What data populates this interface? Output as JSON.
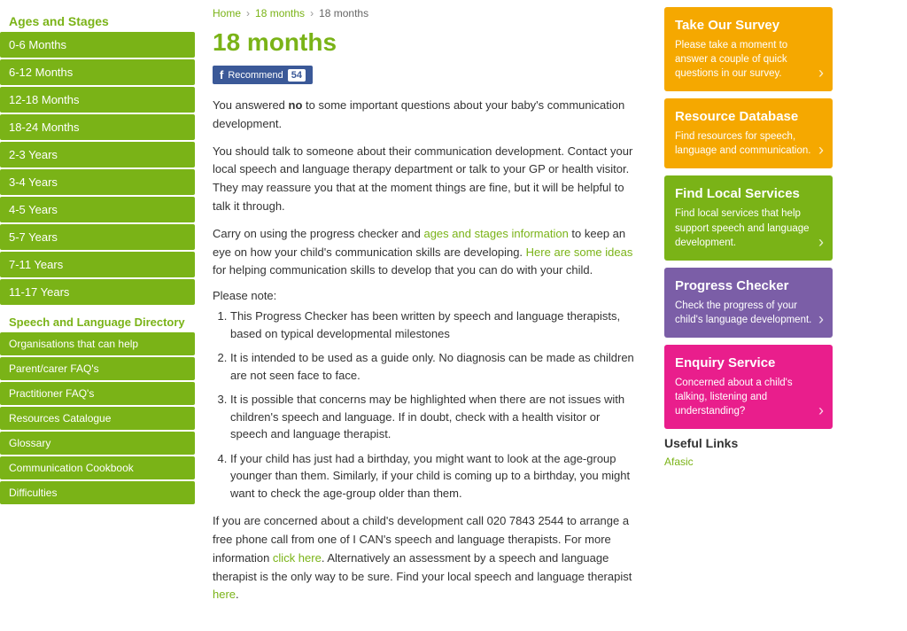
{
  "sidebar": {
    "ages_title": "Ages and Stages",
    "nav_items": [
      "0-6 Months",
      "6-12 Months",
      "12-18 Months",
      "18-24 Months",
      "2-3 Years",
      "3-4 Years",
      "4-5 Years",
      "5-7 Years",
      "7-11 Years",
      "11-17 Years"
    ],
    "directory_title": "Speech and Language Directory",
    "sub_items": [
      "Organisations that can help",
      "Parent/carer FAQ's",
      "Practitioner FAQ's",
      "Resources Catalogue",
      "Glossary",
      "Communication Cookbook",
      "Difficulties"
    ]
  },
  "breadcrumb": {
    "home": "Home",
    "months": "18 months",
    "current": "18 months"
  },
  "main": {
    "heading": "18 months",
    "fb_label": "Recommend",
    "fb_count": "54",
    "para1_pre": "You answered ",
    "para1_bold": "no",
    "para1_post": " to some important questions about your baby's communication development.",
    "para2": "You should talk to someone about their communication development. Contact your local speech and language therapy department or talk to your GP or health visitor. They may reassure you that at the moment things are fine, but it will be helpful to talk it through.",
    "para3_pre": "Carry on using the progress checker and ",
    "para3_link1": "ages and stages information",
    "para3_mid": " to keep an eye on how your child's communication skills are developing. ",
    "para3_link2": "Here are some ideas",
    "para3_post": " for helping communication skills to develop that you can do with your child.",
    "note_label": "Please note:",
    "list_items": [
      "This Progress Checker has been written by speech and language therapists, based on typical developmental milestones",
      "It is intended to be used as a guide only. No diagnosis can be made as children are not seen face to face.",
      "It is possible that concerns may be highlighted when there are not issues with children's speech and language. If in doubt, check with a health visitor or speech and language therapist.",
      "If your child has just had a birthday, you might want to look at the age-group younger than them. Similarly, if your child is coming up to a birthday, you might want to check the age-group older than them."
    ],
    "para4_pre": "If you are concerned about a child's development call 020 7843 2544 to arrange a free phone call from one of I CAN's speech and language therapists. For more information ",
    "para4_link": "click here",
    "para4_post": ". Alternatively an assessment by a speech and language therapist is the only way to be sure. Find your local speech and language therapist ",
    "para4_link2": "here",
    "para4_end": "."
  },
  "widgets": {
    "survey": {
      "title": "Take Our Survey",
      "desc": "Please take a moment to answer a couple of quick questions in our survey."
    },
    "resource": {
      "title": "Resource Database",
      "desc": "Find resources for speech, language and communication."
    },
    "local": {
      "title": "Find Local Services",
      "desc": "Find local services that help support speech and language development."
    },
    "progress": {
      "title": "Progress Checker",
      "desc": "Check the progress of your child's language development."
    },
    "enquiry": {
      "title": "Enquiry Service",
      "desc": "Concerned about a child's talking, listening and understanding?"
    }
  },
  "useful_links": {
    "title": "Useful Links",
    "links": [
      "Afasic"
    ]
  }
}
